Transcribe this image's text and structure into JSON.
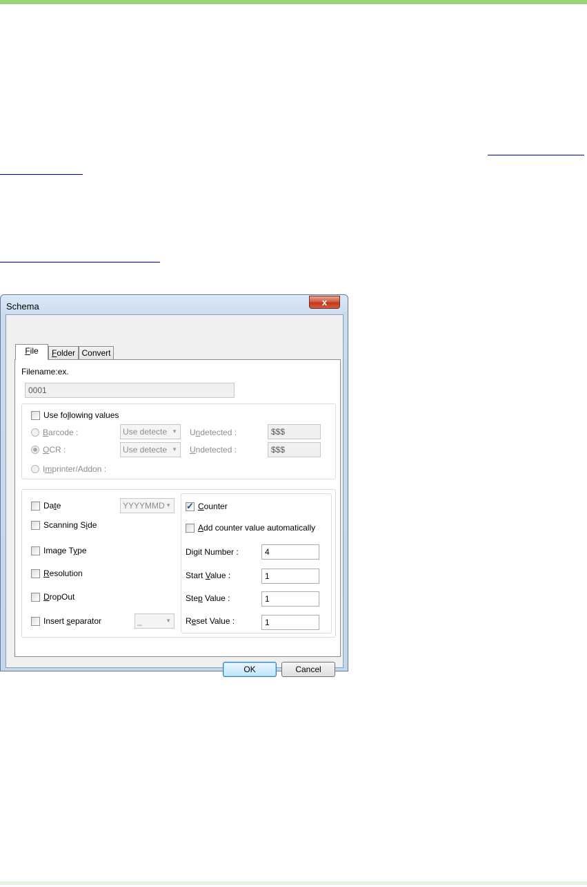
{
  "dialog": {
    "title": "Schema",
    "close_symbol": "x",
    "tabs": [
      {
        "pre": "",
        "key": "F",
        "post": "ile",
        "active": true
      },
      {
        "pre": "",
        "key": "F",
        "post": "older",
        "active": false
      },
      {
        "pre": "",
        "key": "",
        "post": "Convert",
        "active": false
      }
    ],
    "filename_label": "Filename:ex.",
    "filename_value": "0001",
    "use_following": {
      "pre": "Use fo",
      "key": "l",
      "post": "lowing values",
      "checked": false
    },
    "barcode": {
      "label_key": "B",
      "label_rest": "arcode :",
      "combo": "Use detecte",
      "undetected_pre": "U",
      "undetected_key": "n",
      "undetected_post": "detected :",
      "value": "$$$",
      "selected": false
    },
    "ocr": {
      "label_key": "O",
      "label_rest": "CR :",
      "combo": "Use detecte",
      "undetected_pre": "",
      "undetected_key": "U",
      "undetected_post": "ndetected :",
      "value": "$$$",
      "selected": true
    },
    "imprinter": {
      "pre": "I",
      "key": "m",
      "post": "printer/Addon :",
      "selected": false
    },
    "date": {
      "pre": "Da",
      "key": "t",
      "post": "e",
      "checked": false,
      "format": "YYYYMMD"
    },
    "scanning_side": {
      "pre": "Scanning S",
      "key": "i",
      "post": "de",
      "checked": false
    },
    "image_type": {
      "pre": "Image T",
      "key": "y",
      "post": "pe",
      "checked": false
    },
    "resolution": {
      "pre": "",
      "key": "R",
      "post": "esolution",
      "checked": false
    },
    "dropout": {
      "pre": "",
      "key": "D",
      "post": "ropOut",
      "checked": false
    },
    "insert_separator": {
      "pre": "Insert ",
      "key": "s",
      "post": "eparator",
      "checked": false,
      "value": "_"
    },
    "counter": {
      "pre": "",
      "key": "C",
      "post": "ounter",
      "checked": true
    },
    "add_counter": {
      "pre": "",
      "key": "A",
      "post": "dd counter value automatically",
      "checked": false
    },
    "digit_number": {
      "pre": "Di",
      "key": "g",
      "post": "it Number :",
      "value": "4"
    },
    "start_value": {
      "pre": "Start ",
      "key": "V",
      "post": "alue :",
      "value": "1"
    },
    "step_value": {
      "pre": "Ste",
      "key": "p",
      "post": " Value :",
      "value": "1"
    },
    "reset_value": {
      "pre": "R",
      "key": "e",
      "post": "set Value :",
      "value": "1"
    },
    "ok_label": "OK",
    "cancel_label": "Cancel"
  }
}
